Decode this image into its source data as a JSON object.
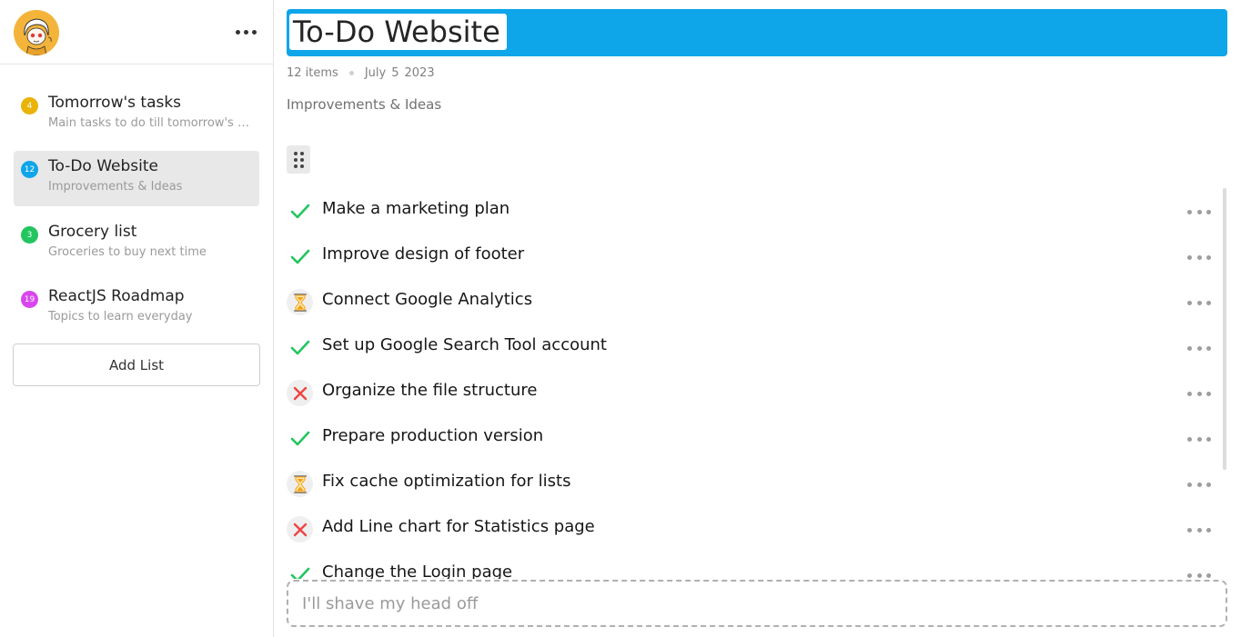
{
  "sidebar": {
    "lists": [
      {
        "count": "4",
        "color": "#eab308",
        "title": "Tomorrow's tasks",
        "subtitle": "Main tasks to do till tomorrow's day"
      },
      {
        "count": "12",
        "color": "#0ea5e9",
        "title": "To-Do Website",
        "subtitle": "Improvements & Ideas",
        "active": true
      },
      {
        "count": "3",
        "color": "#22c55e",
        "title": "Grocery list",
        "subtitle": "Groceries to buy next time"
      },
      {
        "count": "19",
        "color": "#d946ef",
        "title": "ReactJS Roadmap",
        "subtitle": "Topics to learn everyday"
      }
    ],
    "add_list_label": "Add List"
  },
  "main": {
    "title": "To-Do Website",
    "title_color": "#0ea5e9",
    "item_count": "12 items",
    "date_month": "July",
    "date_day": "5",
    "date_year": "2023",
    "description": "Improvements & Ideas",
    "tasks": [
      {
        "text": "Make a marketing plan",
        "status": "done",
        "icon": "check-icon"
      },
      {
        "text": "Improve design of footer",
        "status": "done",
        "icon": "check-icon"
      },
      {
        "text": "Connect Google Analytics",
        "status": "in-progress",
        "icon": "hourglass-icon"
      },
      {
        "text": "Set up Google Search Tool account",
        "status": "done",
        "icon": "check-icon"
      },
      {
        "text": "Organize the file structure",
        "status": "cancelled",
        "icon": "cross-icon"
      },
      {
        "text": "Prepare production version",
        "status": "done",
        "icon": "check-icon"
      },
      {
        "text": "Fix cache optimization for lists",
        "status": "in-progress",
        "icon": "hourglass-icon"
      },
      {
        "text": "Add Line chart for Statistics page",
        "status": "cancelled",
        "icon": "cross-icon"
      },
      {
        "text": "Change the Login page",
        "status": "done",
        "icon": "check-icon"
      }
    ],
    "new_task_placeholder": "I'll shave my head off"
  },
  "colors": {
    "done": "#22c55e",
    "in_progress": "#f59e0b",
    "cancelled": "#ef4444"
  }
}
